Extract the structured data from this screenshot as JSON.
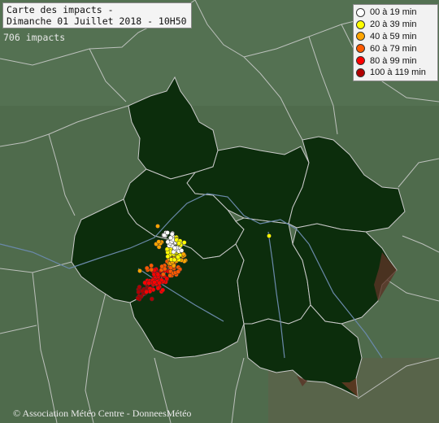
{
  "title": {
    "line1": "Carte des impacts -",
    "line2": "Dimanche 01 Juillet 2018 - 10H50"
  },
  "impact_count": "706 impacts",
  "legend": [
    {
      "label": "00 à 19 min",
      "color": "#ffffff"
    },
    {
      "label": "20 à 39 min",
      "color": "#ffff00"
    },
    {
      "label": "40 à 59 min",
      "color": "#ffa500"
    },
    {
      "label": "60 à 79 min",
      "color": "#ff5a00"
    },
    {
      "label": "80 à 99 min",
      "color": "#ff0000"
    },
    {
      "label": "100 à 119 min",
      "color": "#b00000"
    }
  ],
  "credit": "© Association Météo Centre - DonneesMétéo",
  "colors": {
    "outside_terrain": "#4f6b4c",
    "region_fill": "#0c2d0c",
    "border": "#c9c9c9",
    "river": "#5f7fa0"
  }
}
